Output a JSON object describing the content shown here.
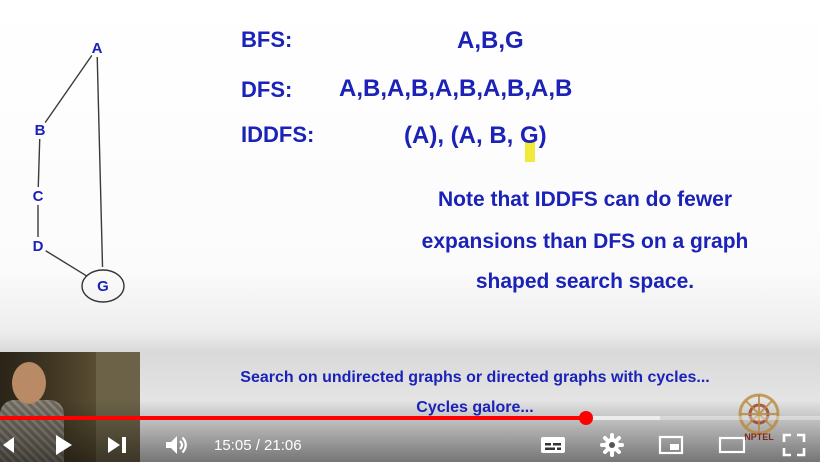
{
  "graph": {
    "nodes": [
      {
        "id": "A",
        "label": "A"
      },
      {
        "id": "B",
        "label": "B"
      },
      {
        "id": "C",
        "label": "C"
      },
      {
        "id": "D",
        "label": "D"
      },
      {
        "id": "G",
        "label": "G"
      }
    ],
    "edges": [
      [
        "A",
        "B"
      ],
      [
        "A",
        "G"
      ],
      [
        "B",
        "C"
      ],
      [
        "C",
        "D"
      ],
      [
        "D",
        "G"
      ]
    ],
    "circled_node": "G"
  },
  "rows": [
    {
      "label": "BFS:",
      "value": "A,B,G"
    },
    {
      "label": "DFS:",
      "value": "A,B,A,B,A,B,A,B,A,B"
    },
    {
      "label": "IDDFS:",
      "value": "(A), (A, B, G)"
    }
  ],
  "note": [
    "Note that IDDFS can do fewer",
    "expansions than DFS on a graph",
    "shaped search space."
  ],
  "footer": {
    "line1": "Search on undirected graphs or directed graphs with cycles...",
    "line2": "Cycles galore..."
  },
  "player": {
    "current_time": "15:05",
    "duration": "21:06",
    "time_display": "15:05 / 21:06",
    "progress_fraction": 0.715,
    "loaded_fraction": 0.805,
    "accent_color": "#ff0000",
    "logo_text": "NPTEL",
    "controls": [
      "previous-icon",
      "play-icon",
      "next-icon",
      "volume-icon",
      "subtitles-icon",
      "settings-icon",
      "miniplayer-icon",
      "theater-icon",
      "fullscreen-icon"
    ]
  }
}
